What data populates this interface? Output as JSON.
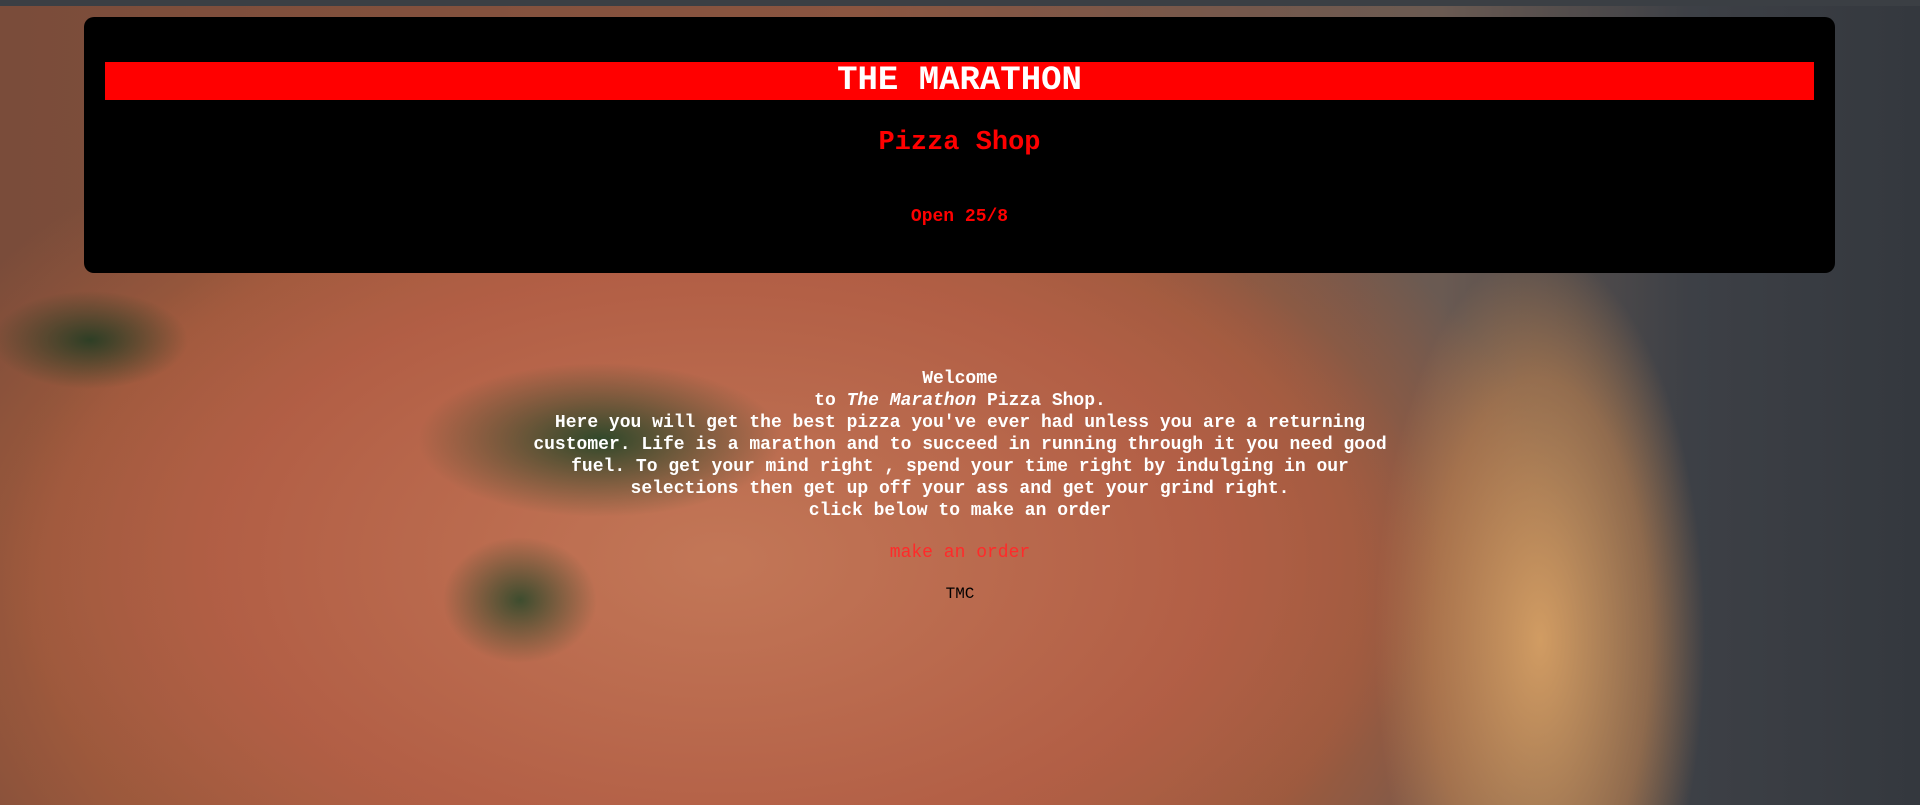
{
  "header": {
    "title": "THE MARATHON",
    "subtitle": "Pizza Shop",
    "hours": "Open 25/8"
  },
  "welcome": {
    "line1": "Welcome",
    "line2_prefix": "to ",
    "line2_em": "The Marathon",
    "line2_suffix": " Pizza Shop.",
    "line3": "Here you will get the best pizza you've ever had unless you are a returning",
    "line4": "customer. Life is a marathon and to succeed in running through it you need good",
    "line5": "fuel. To get your mind right , spend your time right by indulging in our",
    "line6": "selections then get up off your ass and get your grind right.",
    "line7": "click below to make an order"
  },
  "order_link": "make an order",
  "footer": "TMC",
  "colors": {
    "accent": "#ff0000",
    "card": "#000000",
    "text": "#ffffff"
  }
}
